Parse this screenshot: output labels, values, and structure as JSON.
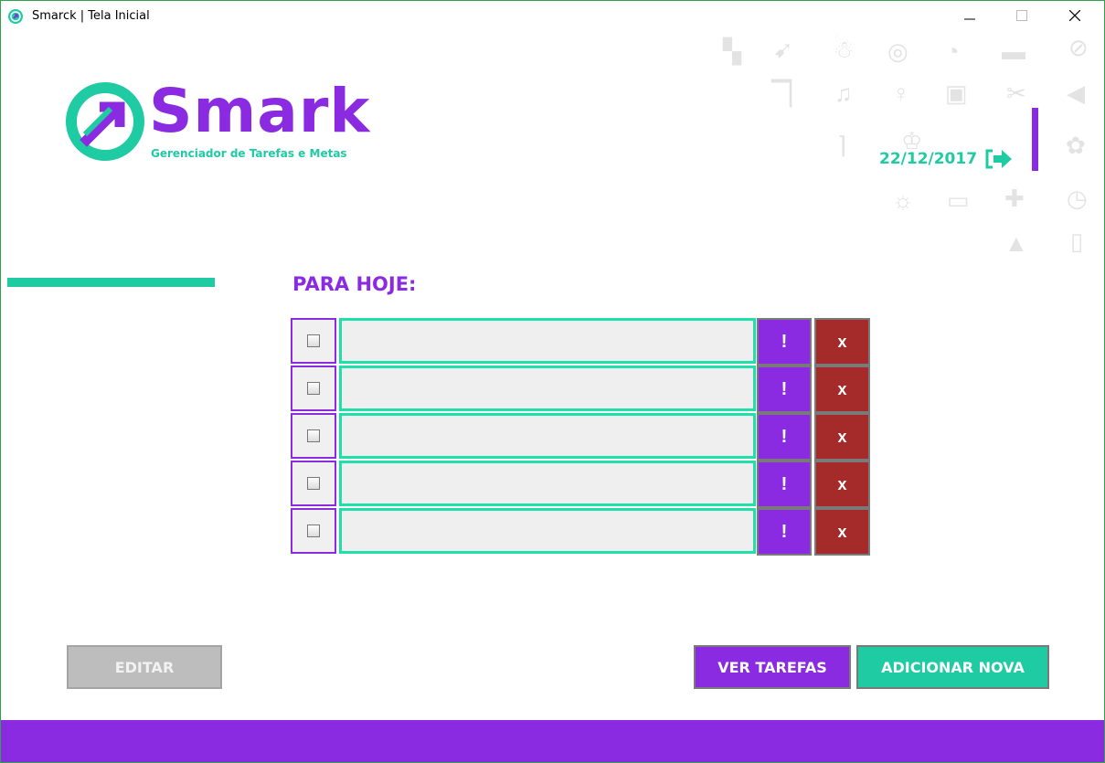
{
  "window": {
    "title": "Smarck | Tela Inicial",
    "minimize_glyph": "—",
    "maximize_glyph": "☐",
    "close_glyph": "✕"
  },
  "logo": {
    "name": "Smark",
    "tagline": "Gerenciador de Tarefas e Metas"
  },
  "header": {
    "date": "22/12/2017",
    "logout_icon": "logout-arrow-icon"
  },
  "section": {
    "title": "PARA HOJE:"
  },
  "tasks": [
    {
      "text": "",
      "priority_label": "!",
      "delete_label": "x"
    },
    {
      "text": "",
      "priority_label": "!",
      "delete_label": "x"
    },
    {
      "text": "",
      "priority_label": "!",
      "delete_label": "x"
    },
    {
      "text": "",
      "priority_label": "!",
      "delete_label": "x"
    },
    {
      "text": "",
      "priority_label": "!",
      "delete_label": "x"
    }
  ],
  "buttons": {
    "edit": "EDITAR",
    "view_tasks": "VER TAREFAS",
    "add_new": "ADICIONAR NOVA"
  },
  "colors": {
    "purple": "#8a2be2",
    "teal": "#1fcba3",
    "dark_red": "#a52a2a",
    "disabled_gray": "#bdbdbd"
  },
  "decorative_icons": [
    "pin-icon",
    "arrow-icon",
    "snowman-icon",
    "compass-icon",
    "speedometer-icon",
    "car-icon",
    "paperclip-icon",
    "flag-icon",
    "music-note-icon",
    "lightbulb-icon",
    "play-icon",
    "scissors-icon",
    "megaphone-icon",
    "crown-icon",
    "wifi-icon",
    "tree-icon",
    "sun-icon",
    "battery-icon",
    "puzzle-icon",
    "clock-icon",
    "graduation-cap-icon",
    "shopping-bag-icon"
  ]
}
